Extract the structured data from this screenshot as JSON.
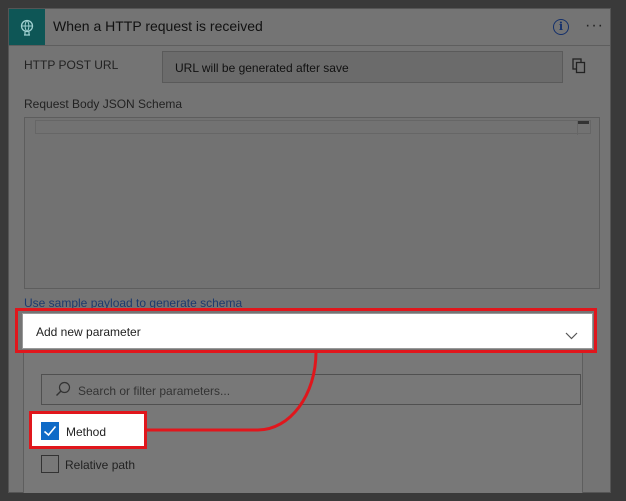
{
  "card": {
    "title": "When a HTTP request is received",
    "trigger_icon": "http-request-trigger-icon",
    "info_icon": "info-icon",
    "more_icon": "more-options-icon"
  },
  "http_post_url": {
    "label": "HTTP POST URL",
    "value": "URL will be generated after save",
    "copy_icon": "copy-icon"
  },
  "schema": {
    "label": "Request Body JSON Schema"
  },
  "sample_payload_link": "Use sample payload to generate schema",
  "add_parameter": {
    "label": "Add new parameter",
    "chevron_icon": "chevron-down-icon",
    "search_placeholder": "Search or filter parameters...",
    "options": [
      {
        "label": "Method",
        "checked": true
      },
      {
        "label": "Relative path",
        "checked": false
      }
    ]
  },
  "colors": {
    "highlight": "#e0161c",
    "checkbox_accent": "#0e6ac7",
    "trigger_icon_bg": "#0e5656",
    "link": "#1d3b6e"
  }
}
